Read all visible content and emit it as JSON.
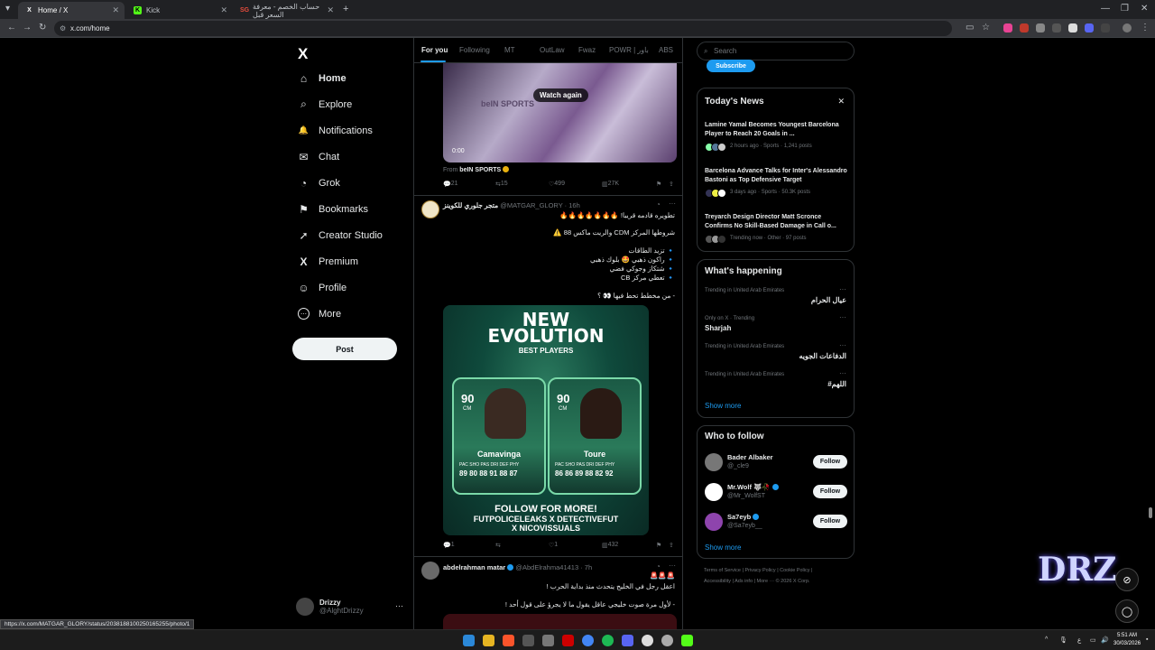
{
  "browser": {
    "tabs": [
      {
        "title": "Home / X",
        "fav": "X",
        "active": true
      },
      {
        "title": "Kick",
        "fav": "K",
        "active": false
      },
      {
        "title": "حساب الخصم - معرفة السعر قبل",
        "fav": "SG",
        "active": false
      }
    ],
    "new_tab": "+",
    "url": "x.com/home",
    "status_url": "https://x.com/MATGAR_GLORY/status/2038188100250165255/photo/1"
  },
  "sidebar": {
    "logo": "X",
    "items": [
      {
        "label": "Home",
        "icon": "home-icon",
        "glyph": "⌂"
      },
      {
        "label": "Explore",
        "icon": "search-icon",
        "glyph": "⌕"
      },
      {
        "label": "Notifications",
        "icon": "bell-icon",
        "glyph": "🔔"
      },
      {
        "label": "Chat",
        "icon": "mail-icon",
        "glyph": "✉"
      },
      {
        "label": "Grok",
        "icon": "grok-icon",
        "glyph": "◔"
      },
      {
        "label": "Bookmarks",
        "icon": "bookmark-icon",
        "glyph": "⚑"
      },
      {
        "label": "Creator Studio",
        "icon": "rocket-icon",
        "glyph": "➚"
      },
      {
        "label": "Premium",
        "icon": "x-icon",
        "glyph": "X"
      },
      {
        "label": "Profile",
        "icon": "person-icon",
        "glyph": "☺"
      },
      {
        "label": "More",
        "icon": "more-circle-icon",
        "glyph": "⋯"
      }
    ],
    "post_label": "Post",
    "account": {
      "name": "Drizzy",
      "handle": "@AlghtDrizzy",
      "menu": "···"
    }
  },
  "feed": {
    "tabs": [
      "For you",
      "Following",
      "MT",
      "OutLaw",
      "Fwaz",
      "POWR | باور",
      "ABS"
    ],
    "video": {
      "overlay": "Watch again",
      "brand": "beIN SPORTS",
      "time": "0:00",
      "from_label": "From",
      "from_source": "beIN SPORTS"
    },
    "tweet1_actions": {
      "replies": "21",
      "reposts": "15",
      "likes": "499",
      "views": "27K"
    },
    "tweet2": {
      "name": "متجر جلوري للكوينز",
      "handle": "@MATGAR_GLORY · 16h",
      "lines": [
        "تطويره قادمه قريبا! 🔥🔥🔥🔥🔥🔥🔥",
        "شروطها المركز CDM والريت ماكس 88 ⚠️",
        "🔹 تزيد الطاقات",
        "🔹 راكون ذهبي 🤩 بلوك ذهبي",
        "🔹 شتكاز وجوكي فضي",
        "🔹 تعطي مركز CB",
        "- من مخطط تحط فيها 👀 ؟"
      ],
      "image": {
        "title1": "NEW",
        "title2": "EVOLUTION",
        "subtitle": "BEST PLAYERS",
        "players": [
          {
            "rating": "90",
            "pos": "CM",
            "name": "Camavinga",
            "stat_labels": "PAC SHO PAS DRI DEF PHY",
            "stats": "89 80 88 91 88 87"
          },
          {
            "rating": "90",
            "pos": "CM",
            "name": "Toure",
            "stat_labels": "PAC SHO PAS DRI DEF PHY",
            "stats": "86 86 89 88 82 92"
          }
        ],
        "footer1": "FOLLOW FOR MORE!",
        "footer2": "FUTPOLICELEAKS X DETECTIVEFUT",
        "footer3": "X NICOVISSUALS"
      },
      "actions": {
        "replies": "1",
        "reposts": "",
        "likes": "1",
        "views": "432"
      }
    },
    "tweet3": {
      "name": "abdelrahman matar",
      "handle": "@AbdElrahma41413 · 7h",
      "lines": [
        "🚨🚨🚨",
        "اعقل رجل في الخليج يتحدث منذ بداية الحرب !",
        "- لأول مرة صوت خليجي عاقل يقول ما لا يجرؤ على قول أحد !"
      ]
    }
  },
  "right": {
    "search_placeholder": "Search",
    "subscribe": "Subscribe",
    "news": {
      "title": "Today's News",
      "close": "✕",
      "items": [
        {
          "title": "Lamine Yamal Becomes Youngest Barcelona Player to Reach 20 Goals in ...",
          "meta": "2 hours ago · Sports · 1,241 posts"
        },
        {
          "title": "Barcelona Advance Talks for Inter's Alessandro Bastoni as Top Defensive Target",
          "meta": "3 days ago · Sports · 50.3K posts"
        },
        {
          "title": "Treyarch Design Director Matt Scronce Confirms No Skill-Based Damage in Call o...",
          "meta": "Trending now · Other · 97 posts"
        }
      ]
    },
    "happening": {
      "title": "What's happening",
      "items": [
        {
          "context": "Trending in United Arab Emirates",
          "name": "عيال الحرام"
        },
        {
          "context": "Only on X · Trending",
          "name": "Sharjah"
        },
        {
          "context": "Trending in United Arab Emirates",
          "name": "الدفاعات الجويه"
        },
        {
          "context": "Trending in United Arab Emirates",
          "name": "#اللهم"
        }
      ],
      "show_more": "Show more"
    },
    "who_to_follow": {
      "title": "Who to follow",
      "users": [
        {
          "name": "Bader Albaker",
          "handle": "@_cle9"
        },
        {
          "name": "Mr.Wolf 🐺🥀",
          "handle": "@Mr_WolfST"
        },
        {
          "name": "Sa7eyb",
          "handle": "@Sa7eyb__"
        }
      ],
      "follow_label": "Follow",
      "show_more": "Show more"
    },
    "footer": {
      "line1": "Terms of Service  |  Privacy Policy  |  Cookie Policy  |",
      "line2": "Accessibility  |  Ads info  |  More ···  © 2026 X Corp."
    }
  },
  "overlay": {
    "logo_text": "DRZ"
  },
  "taskbar": {
    "time": "5:51 AM",
    "date": "30/03/2026",
    "lang": "ع"
  }
}
